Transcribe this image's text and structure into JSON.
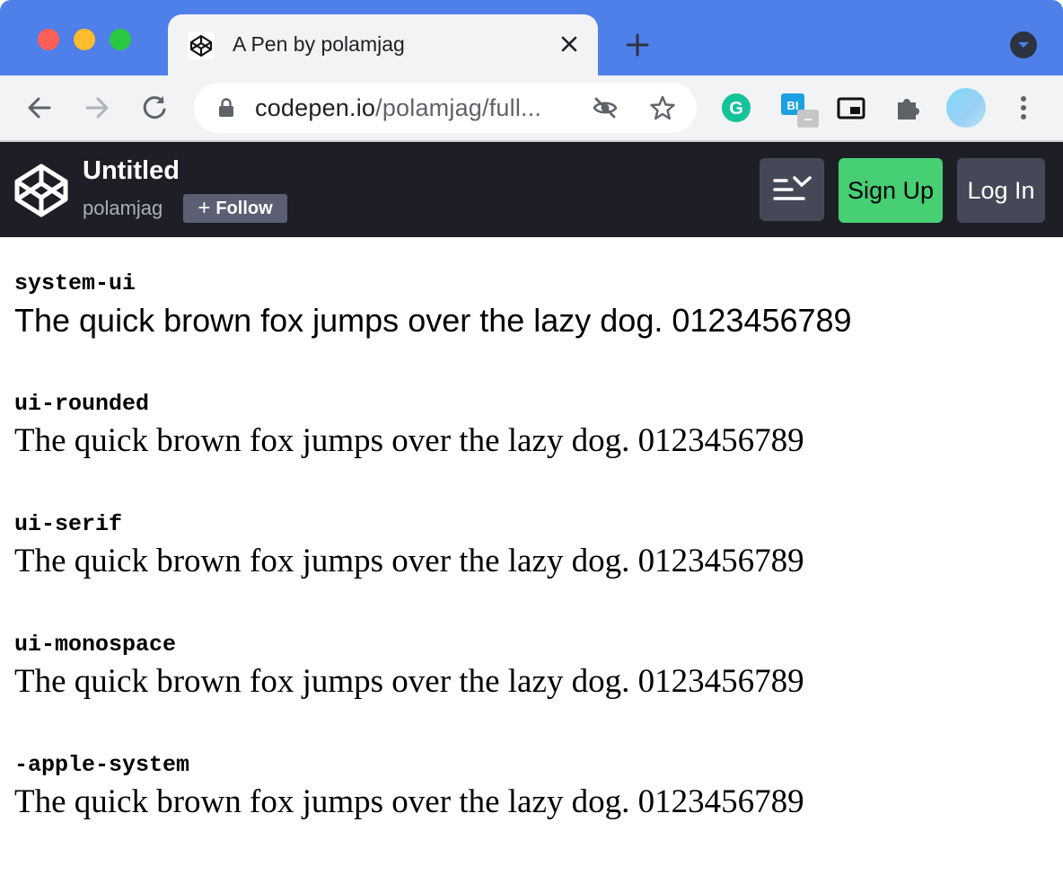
{
  "browser": {
    "tab": {
      "title": "A Pen by polamjag"
    },
    "address": {
      "host": "codepen.io",
      "path": "/polamjag/full..."
    },
    "extensions": [
      {
        "name": "grammarly",
        "label": "G",
        "color": "#15c39a"
      },
      {
        "name": "bi",
        "label": "BI",
        "color": "#1ba1e2"
      }
    ]
  },
  "codepen": {
    "pen_title": "Untitled",
    "username": "polamjag",
    "follow_label": "Follow",
    "follow_plus": "+",
    "signup_label": "Sign Up",
    "login_label": "Log In",
    "brand_green": "#47cf73",
    "header_bg": "#1e1f26"
  },
  "samples": [
    {
      "font": "system-ui",
      "text": "The quick brown fox jumps over the lazy dog. 0123456789"
    },
    {
      "font": "ui-rounded",
      "text": "The quick brown fox jumps over the lazy dog. 0123456789"
    },
    {
      "font": "ui-serif",
      "text": "The quick brown fox jumps over the lazy dog. 0123456789"
    },
    {
      "font": "ui-monospace",
      "text": "The quick brown fox jumps over the lazy dog. 0123456789"
    },
    {
      "font": "-apple-system",
      "text": "The quick brown fox jumps over the lazy dog. 0123456789"
    }
  ]
}
